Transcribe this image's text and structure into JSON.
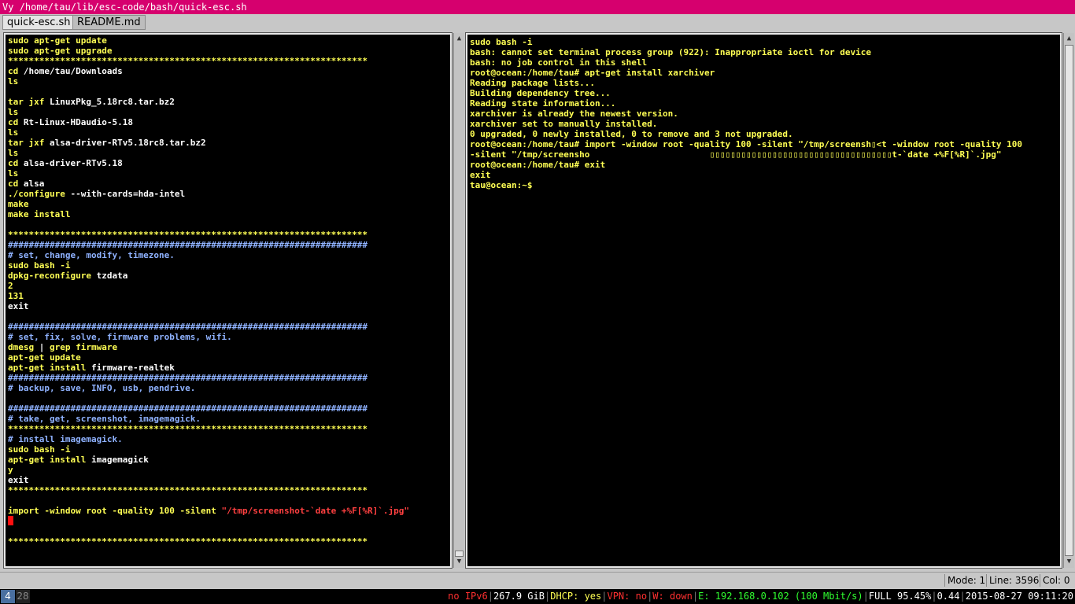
{
  "window": {
    "title": "Vy /home/tau/lib/esc-code/bash/quick-esc.sh"
  },
  "tabs": [
    {
      "label": "quick-esc.sh",
      "active": true
    },
    {
      "label": "README.md",
      "active": false
    }
  ],
  "editor": {
    "lines": [
      {
        "segs": [
          {
            "t": "sudo apt-get update",
            "c": "y"
          }
        ]
      },
      {
        "segs": [
          {
            "t": "sudo apt-get upgrade",
            "c": "y"
          }
        ]
      },
      {
        "segs": [
          {
            "t": "*********************************************************************",
            "c": "y"
          }
        ]
      },
      {
        "segs": [
          {
            "t": "cd ",
            "c": "y"
          },
          {
            "t": "/home/tau/Downloads",
            "c": "w"
          }
        ]
      },
      {
        "segs": [
          {
            "t": "ls",
            "c": "y"
          }
        ]
      },
      {
        "segs": [
          {
            "t": "",
            "c": "y"
          }
        ]
      },
      {
        "segs": [
          {
            "t": "tar jxf ",
            "c": "y"
          },
          {
            "t": "LinuxPkg_5.18rc8.tar.bz2",
            "c": "w"
          }
        ]
      },
      {
        "segs": [
          {
            "t": "ls",
            "c": "y"
          }
        ]
      },
      {
        "segs": [
          {
            "t": "cd ",
            "c": "y"
          },
          {
            "t": "Rt-Linux-HDaudio-5.18",
            "c": "w"
          }
        ]
      },
      {
        "segs": [
          {
            "t": "ls",
            "c": "y"
          }
        ]
      },
      {
        "segs": [
          {
            "t": "tar jxf ",
            "c": "y"
          },
          {
            "t": "alsa-driver-RTv5.18rc8.tar.bz2",
            "c": "w"
          }
        ]
      },
      {
        "segs": [
          {
            "t": "ls",
            "c": "y"
          }
        ]
      },
      {
        "segs": [
          {
            "t": "cd ",
            "c": "y"
          },
          {
            "t": "alsa-driver-RTv5.18",
            "c": "w"
          }
        ]
      },
      {
        "segs": [
          {
            "t": "ls",
            "c": "y"
          }
        ]
      },
      {
        "segs": [
          {
            "t": "cd ",
            "c": "y"
          },
          {
            "t": "alsa",
            "c": "w"
          }
        ]
      },
      {
        "segs": [
          {
            "t": "./configure ",
            "c": "y"
          },
          {
            "t": "--with-cards=hda-intel",
            "c": "w"
          }
        ]
      },
      {
        "segs": [
          {
            "t": "make",
            "c": "y"
          }
        ]
      },
      {
        "segs": [
          {
            "t": "make install",
            "c": "y"
          }
        ]
      },
      {
        "segs": [
          {
            "t": "",
            "c": "y"
          }
        ]
      },
      {
        "segs": [
          {
            "t": "*********************************************************************",
            "c": "y"
          }
        ]
      },
      {
        "segs": [
          {
            "t": "#####################################################################",
            "c": "b"
          }
        ]
      },
      {
        "segs": [
          {
            "t": "# set, change, modify, timezone.",
            "c": "b"
          }
        ]
      },
      {
        "segs": [
          {
            "t": "sudo bash -i",
            "c": "y"
          }
        ]
      },
      {
        "segs": [
          {
            "t": "dpkg-reconfigure ",
            "c": "y"
          },
          {
            "t": "tzdata",
            "c": "w"
          }
        ]
      },
      {
        "segs": [
          {
            "t": "2",
            "c": "y"
          }
        ]
      },
      {
        "segs": [
          {
            "t": "131",
            "c": "y"
          }
        ]
      },
      {
        "segs": [
          {
            "t": "exit",
            "c": "w"
          }
        ]
      },
      {
        "segs": [
          {
            "t": "",
            "c": "y"
          }
        ]
      },
      {
        "segs": [
          {
            "t": "#####################################################################",
            "c": "b"
          }
        ]
      },
      {
        "segs": [
          {
            "t": "# set, fix, solve, firmware problems, wifi.",
            "c": "b"
          }
        ]
      },
      {
        "segs": [
          {
            "t": "dmesg ",
            "c": "y"
          },
          {
            "t": "| ",
            "c": "w"
          },
          {
            "t": "grep firmware",
            "c": "y"
          }
        ]
      },
      {
        "segs": [
          {
            "t": "apt-get update",
            "c": "y"
          }
        ]
      },
      {
        "segs": [
          {
            "t": "apt-get install ",
            "c": "y"
          },
          {
            "t": "firmware-realtek",
            "c": "w"
          }
        ]
      },
      {
        "segs": [
          {
            "t": "#####################################################################",
            "c": "b"
          }
        ]
      },
      {
        "segs": [
          {
            "t": "# backup, save, INFO, usb, pendrive.",
            "c": "b"
          }
        ]
      },
      {
        "segs": [
          {
            "t": "",
            "c": "y"
          }
        ]
      },
      {
        "segs": [
          {
            "t": "#####################################################################",
            "c": "b"
          }
        ]
      },
      {
        "segs": [
          {
            "t": "# take, get, screenshot, imagemagick.",
            "c": "b"
          }
        ]
      },
      {
        "segs": [
          {
            "t": "*********************************************************************",
            "c": "y"
          }
        ]
      },
      {
        "segs": [
          {
            "t": "# install imagemagick.",
            "c": "b"
          }
        ]
      },
      {
        "segs": [
          {
            "t": "sudo bash -i",
            "c": "y"
          }
        ]
      },
      {
        "segs": [
          {
            "t": "apt-get install ",
            "c": "y"
          },
          {
            "t": "imagemagick",
            "c": "w"
          }
        ]
      },
      {
        "segs": [
          {
            "t": "y",
            "c": "y"
          }
        ]
      },
      {
        "segs": [
          {
            "t": "exit",
            "c": "w"
          }
        ]
      },
      {
        "segs": [
          {
            "t": "*********************************************************************",
            "c": "y"
          }
        ]
      },
      {
        "segs": [
          {
            "t": "",
            "c": "y"
          }
        ]
      },
      {
        "segs": [
          {
            "t": "import -window root -quality 100 -silent ",
            "c": "y"
          },
          {
            "t": "\"/tmp/screenshot-`date +%F[%R]`.jpg\"",
            "c": "r"
          }
        ]
      },
      {
        "segs": [
          {
            "t": "",
            "c": "y"
          }
        ],
        "cursor": true
      },
      {
        "segs": [
          {
            "t": "",
            "c": "y"
          }
        ]
      },
      {
        "segs": [
          {
            "t": "*********************************************************************",
            "c": "y"
          }
        ]
      }
    ]
  },
  "terminal": {
    "lines": [
      "sudo bash -i",
      "bash: cannot set terminal process group (922): Inappropriate ioctl for device",
      "bash: no job control in this shell",
      "root@ocean:/home/tau# apt-get install xarchiver",
      "Reading package lists...",
      "Building dependency tree...",
      "Reading state information...",
      "xarchiver is already the newest version.",
      "xarchiver set to manually installed.",
      "0 upgraded, 0 newly installed, 0 to remove and 3 not upgraded.",
      "root@ocean:/home/tau# import -window root -quality 100 -silent \"/tmp/screensh▯<t -window root -quality 100",
      "-silent \"/tmp/screensho                       ▯▯▯▯▯▯▯▯▯▯▯▯▯▯▯▯▯▯▯▯▯▯▯▯▯▯▯▯▯▯▯▯▯▯▯t-`date +%F[%R]`.jpg\"",
      "root@ocean:/home/tau# exit",
      "exit",
      "tau@ocean:~$"
    ]
  },
  "status": {
    "mode": "Mode: 1",
    "line": "Line: 3596",
    "col": "Col: 0"
  },
  "taskbar": {
    "workspaces": [
      "4",
      "28"
    ],
    "items": [
      {
        "t": "no IPv6",
        "color": "#ff3030"
      },
      {
        "t": "267.9 GiB",
        "color": "#ffffff"
      },
      {
        "t": "DHCP: yes",
        "color": "#ffff54"
      },
      {
        "t": "VPN: no",
        "color": "#ff3030"
      },
      {
        "t": "W: down",
        "color": "#ff3030"
      },
      {
        "t": "E: 192.168.0.102 (100 Mbit/s)",
        "color": "#30ff30"
      },
      {
        "t": "FULL 95.45%",
        "color": "#ffffff"
      },
      {
        "t": "0.44",
        "color": "#ffffff"
      },
      {
        "t": "2015-08-27 09:11:20",
        "color": "#ffffff"
      }
    ]
  },
  "colors": {
    "titlebar": "#d6006e",
    "keyword": "#ffff54",
    "comment": "#8fb2ff",
    "string": "#ff4040",
    "cursor": "#ff1010"
  }
}
